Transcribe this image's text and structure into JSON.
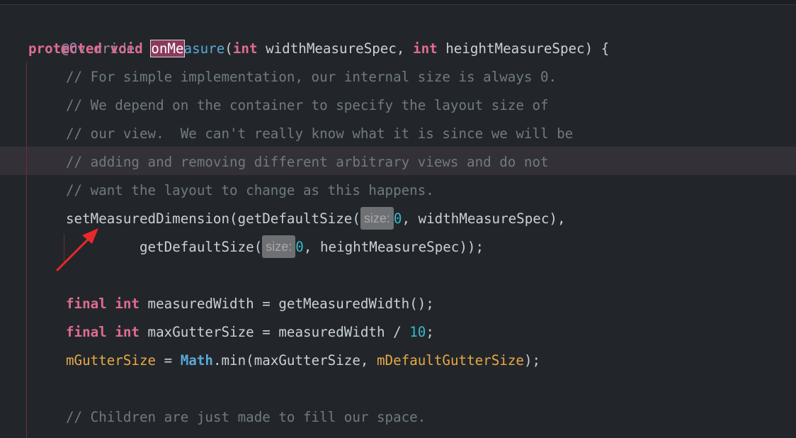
{
  "colors": {
    "background": "#22262b",
    "keyword": "#e06c8f",
    "annotation": "#9c86b5",
    "comment": "#6f7a82",
    "number": "#36b9c9",
    "field": "#e6a944",
    "class_ref": "#5aa8d8",
    "arrow": "#e8282a"
  },
  "code": {
    "annotation": "@Override",
    "sig_protected": "protected",
    "sig_void": "void",
    "sig_method_selected": "onMe",
    "sig_method_rest": "asure",
    "sig_paren_open": "(",
    "sig_int1": "int",
    "sig_param1": " widthMeasureSpec, ",
    "sig_int2": "int",
    "sig_param2": " heightMeasureSpec) {",
    "comment1": "// For simple implementation, our internal size is always 0.",
    "comment2": "// We depend on the container to specify the layout size of",
    "comment3": "// our view.  We can't really know what it is since we will be",
    "comment4": "// adding and removing different arbitrary views and do not",
    "comment5": "// want the layout to change as this happens.",
    "set_call": "setMeasuredDimension(getDefaultSize(",
    "hint_label": "size:",
    "zero": "0",
    "set_rest": ", widthMeasureSpec),",
    "get_call": "getDefaultSize(",
    "get_rest": ", heightMeasureSpec));",
    "final": "final",
    "int": "int",
    "mw_decl": " measuredWidth = getMeasuredWidth();",
    "mg_decl": " maxGutterSize = measuredWidth / ",
    "ten": "10",
    "semicolon": ";",
    "gutter_field": "mGutterSize",
    "assign": " = ",
    "math": "Math",
    "min_call": ".min(maxGutterSize, ",
    "default_gutter": "mDefaultGutterSize",
    "close_paren": ");",
    "comment6": "// Children are just made to fill our space."
  }
}
